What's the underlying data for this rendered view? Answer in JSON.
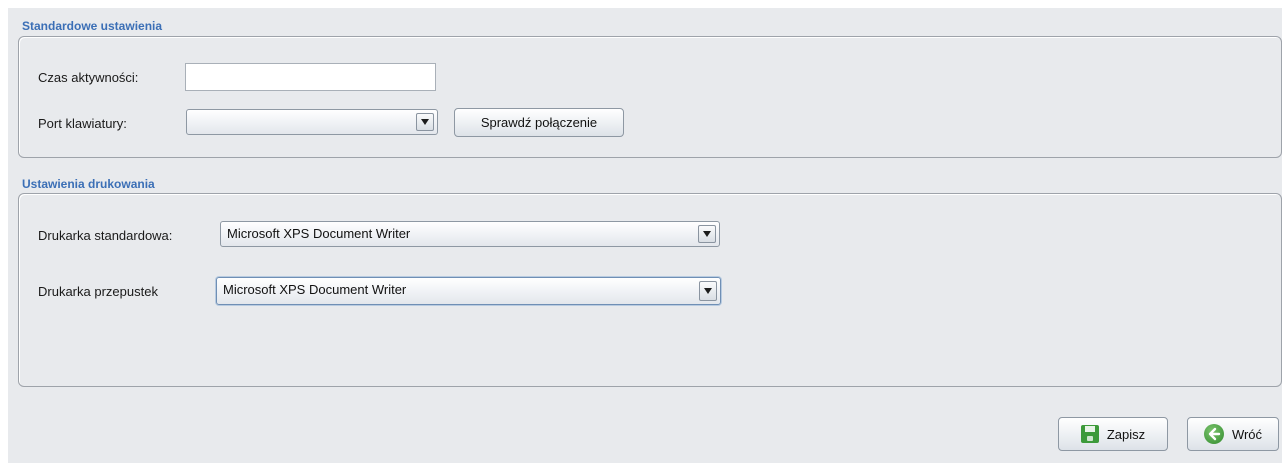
{
  "colors": {
    "section_title": "#3b6fb6",
    "panel_background": "#e8eaed"
  },
  "default_settings": {
    "title": "Standardowe ustawienia",
    "activity_time_label": "Czas aktywności:",
    "activity_time_value": "",
    "keyboard_port_label": "Port klawiatury:",
    "keyboard_port_value": "",
    "check_connection_label": "Sprawdź połączenie"
  },
  "print_settings": {
    "title": "Ustawienia drukowania",
    "default_printer_label": "Drukarka standardowa:",
    "default_printer_value": "Microsoft XPS Document Writer",
    "pass_printer_label": "Drukarka przepustek",
    "pass_printer_value": "Microsoft XPS Document Writer"
  },
  "footer": {
    "save_label": "Zapisz",
    "save_icon": "floppy-save-icon",
    "back_label": "Wróć",
    "back_icon": "back-arrow-icon"
  }
}
